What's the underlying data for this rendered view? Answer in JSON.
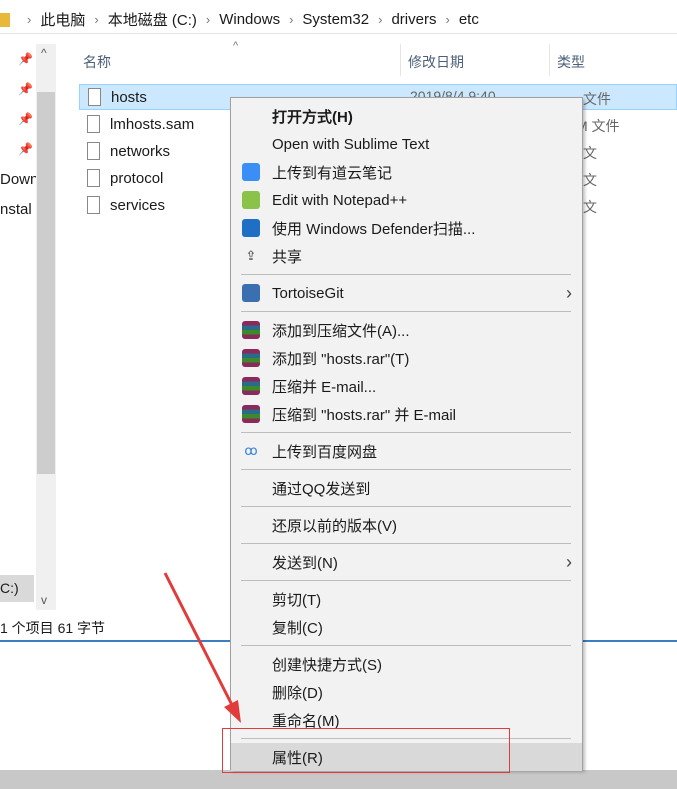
{
  "breadcrumb": [
    "此电脑",
    "本地磁盘 (C:)",
    "Windows",
    "System32",
    "drivers",
    "etc"
  ],
  "nav": {
    "items": [
      "Down",
      "nstal"
    ],
    "selected": "C:)"
  },
  "columns": {
    "name": "名称",
    "date": "修改日期",
    "type": "类型"
  },
  "files": [
    {
      "name": "hosts",
      "date": "2019/8/4 9:40",
      "type": "文件",
      "selected": true
    },
    {
      "name": "lmhosts.sam",
      "type": "M 文件"
    },
    {
      "name": "networks",
      "type": "文"
    },
    {
      "name": "protocol",
      "type": "文"
    },
    {
      "name": "services",
      "type": "文"
    }
  ],
  "status": "1 个项目  61 字节",
  "menu": [
    {
      "label": "打开方式(H)",
      "bold": true
    },
    {
      "label": "Open with Sublime Text"
    },
    {
      "label": "上传到有道云笔记",
      "icon": "youdao-note-icon",
      "color": "#3a8ef6"
    },
    {
      "label": "Edit with Notepad++",
      "icon": "notepad-plus-plus-icon",
      "color": "#8bc34a"
    },
    {
      "label": "使用 Windows Defender扫描...",
      "icon": "windows-defender-shield-icon",
      "color": "#1f6fc5"
    },
    {
      "label": "共享",
      "icon": "share-icon"
    },
    {
      "sep": true
    },
    {
      "label": "TortoiseGit",
      "icon": "tortoisegit-icon",
      "color": "#3a6fb0",
      "submenu": true
    },
    {
      "sep": true
    },
    {
      "label": "添加到压缩文件(A)...",
      "icon": "winrar-icon",
      "color": "#8b2a5a"
    },
    {
      "label": "添加到 \"hosts.rar\"(T)",
      "icon": "winrar-icon",
      "color": "#8b2a5a"
    },
    {
      "label": "压缩并 E-mail...",
      "icon": "winrar-icon",
      "color": "#8b2a5a"
    },
    {
      "label": "压缩到 \"hosts.rar\" 并 E-mail",
      "icon": "winrar-icon",
      "color": "#8b2a5a"
    },
    {
      "sep": true
    },
    {
      "label": "上传到百度网盘",
      "icon": "baidu-netdisk-icon",
      "color": "#2f7de1"
    },
    {
      "sep": true
    },
    {
      "label": "通过QQ发送到"
    },
    {
      "sep": true
    },
    {
      "label": "还原以前的版本(V)"
    },
    {
      "sep": true
    },
    {
      "label": "发送到(N)",
      "submenu": true
    },
    {
      "sep": true
    },
    {
      "label": "剪切(T)"
    },
    {
      "label": "复制(C)"
    },
    {
      "sep": true
    },
    {
      "label": "创建快捷方式(S)"
    },
    {
      "label": "删除(D)"
    },
    {
      "label": "重命名(M)"
    },
    {
      "sep": true
    },
    {
      "label": "属性(R)",
      "highlighted": true
    }
  ],
  "annotation_color": "#e23b3b"
}
